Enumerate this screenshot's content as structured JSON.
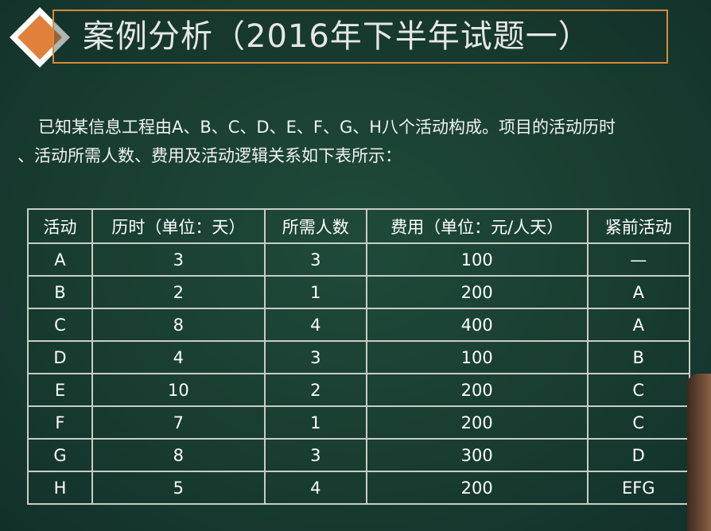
{
  "title": "案例分析（2016年下半年试题一）",
  "intro": {
    "line1": "已知某信息工程由A、B、C、D、E、F、G、H八个活动构成。项目的活动历时",
    "line2": "、活动所需人数、费用及活动逻辑关系如下表所示："
  },
  "table": {
    "headers": [
      "活动",
      "历时（单位：天）",
      "所需人数",
      "费用（单位：元/人天）",
      "紧前活动"
    ],
    "rows": [
      [
        "A",
        "3",
        "3",
        "100",
        "—"
      ],
      [
        "B",
        "2",
        "1",
        "200",
        "A"
      ],
      [
        "C",
        "8",
        "4",
        "400",
        "A"
      ],
      [
        "D",
        "4",
        "3",
        "100",
        "B"
      ],
      [
        "E",
        "10",
        "2",
        "200",
        "C"
      ],
      [
        "F",
        "7",
        "1",
        "200",
        "C"
      ],
      [
        "G",
        "8",
        "3",
        "300",
        "D"
      ],
      [
        "H",
        "5",
        "4",
        "200",
        "EFG"
      ]
    ]
  },
  "colors": {
    "background": "#1b4034",
    "title_border": "#d98b3a",
    "diamond": "#e0803a",
    "table_border": "#c9ccc6"
  }
}
